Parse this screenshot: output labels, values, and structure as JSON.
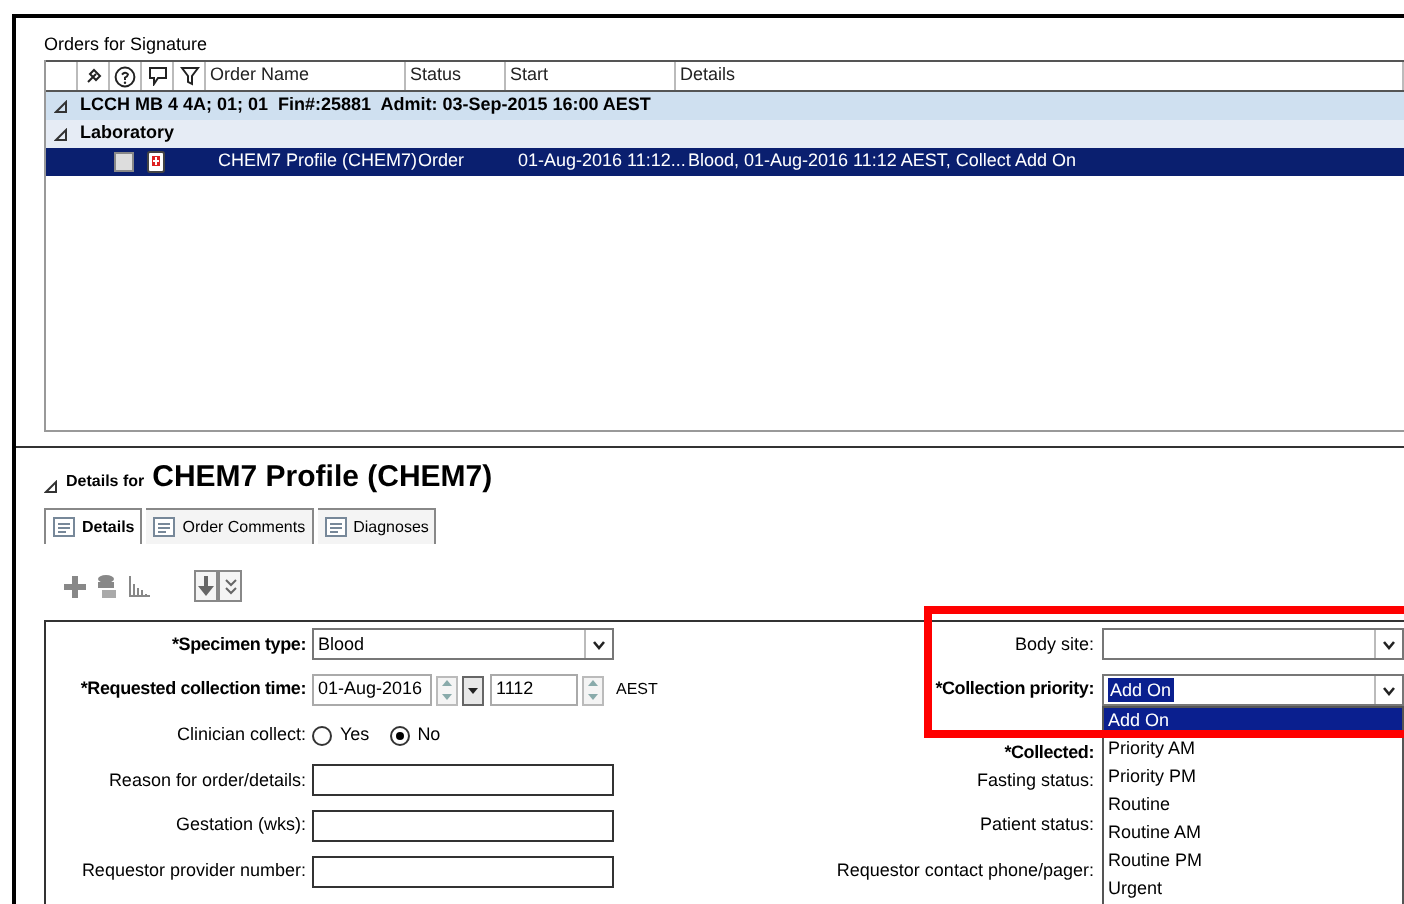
{
  "orders_panel": {
    "title": "Orders for Signature",
    "columns": [
      "Order Name",
      "Status",
      "Start",
      "Details"
    ],
    "encounter": {
      "label": "LCCH MB 4 4A; 01; 01  Fin#:25881  Admit: 03-Sep-2015 16:00 AEST",
      "expanded": true
    },
    "category": {
      "label": "Laboratory",
      "expanded": true
    },
    "rows": [
      {
        "order_name": "CHEM7 Profile (CHEM7)",
        "status": "Order",
        "start": "01-Aug-2016 11:12...",
        "details": "Blood, 01-Aug-2016 11:12 AEST, Collect Add On",
        "selected": true,
        "checked": false
      }
    ]
  },
  "details_panel": {
    "prefix": "Details for",
    "title": "CHEM7 Profile (CHEM7)",
    "expanded": true,
    "tabs": [
      {
        "label": "Details",
        "selected": true
      },
      {
        "label": "Order Comments",
        "selected": false
      },
      {
        "label": "Diagnoses",
        "selected": false
      }
    ],
    "left_fields": [
      {
        "kind": "select",
        "label": "*Specimen type:",
        "required": true,
        "value": "Blood"
      },
      {
        "kind": "datetime",
        "label": "*Requested collection time:",
        "required": true,
        "date": "01-Aug-2016",
        "time": "1112",
        "zone": "AEST"
      },
      {
        "kind": "radio",
        "label": "Clinician collect:",
        "required": false,
        "options": [
          {
            "label": "Yes",
            "selected": false
          },
          {
            "label": "No",
            "selected": true
          }
        ]
      },
      {
        "kind": "text",
        "label": "Reason for order/details:",
        "required": false
      },
      {
        "kind": "text",
        "label": "Gestation (wks):",
        "required": false
      },
      {
        "kind": "text",
        "label": "Requestor provider number:",
        "required": false
      }
    ],
    "right_fields": [
      {
        "kind": "select",
        "label": "Body site:",
        "required": false
      },
      {
        "kind": "select",
        "label": "*Collection priority:",
        "required": true,
        "value": "Add On",
        "open": true,
        "options": [
          {
            "label": "Add On",
            "selected": true
          },
          {
            "label": "Priority AM",
            "selected": false
          },
          {
            "label": "Priority PM",
            "selected": false
          },
          {
            "label": "Routine",
            "selected": false
          },
          {
            "label": "Routine AM",
            "selected": false
          },
          {
            "label": "Routine PM",
            "selected": false
          },
          {
            "label": "Urgent",
            "selected": false
          }
        ]
      },
      {
        "kind": "label",
        "label": "*Collected:",
        "required": true
      },
      {
        "kind": "label",
        "label": "Fasting status:",
        "required": false
      },
      {
        "kind": "label",
        "label": "Patient status:",
        "required": false
      },
      {
        "kind": "label",
        "label": "Requestor contact phone/pager:",
        "required": false
      }
    ]
  }
}
